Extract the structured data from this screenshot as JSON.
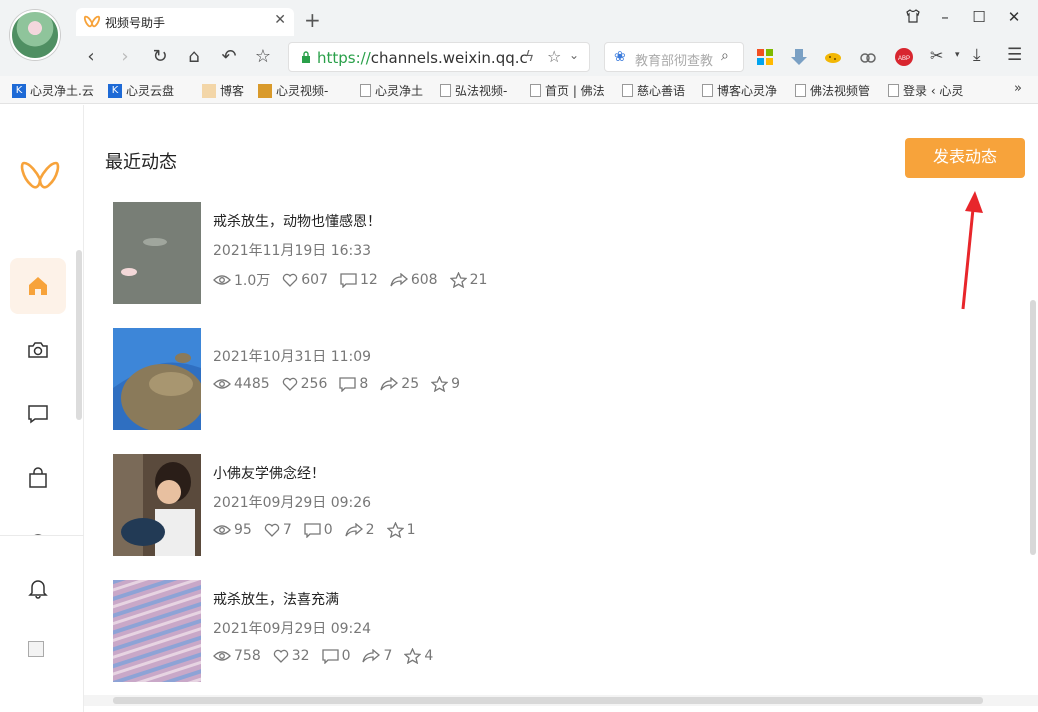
{
  "browser": {
    "tab_title": "视频号助手",
    "url_scheme": "https://",
    "url_host": "channels.weixin.qq.co",
    "search_text": "教育部彻查教",
    "bookmarks": [
      "心灵净土.云",
      "心灵云盘",
      "博客",
      "心灵视频-",
      "心灵净土",
      "弘法视频-",
      "首页 | 佛法",
      "慈心善语",
      "博客心灵净",
      "佛法视频管",
      "登录 ‹ 心灵"
    ],
    "bookmarks_more": "»"
  },
  "page": {
    "section_title": "最近动态",
    "publish_button": "发表动态",
    "accent_color": "#f7a33b"
  },
  "sidebar": {
    "items": [
      {
        "name": "home",
        "icon": "home-icon",
        "active": true
      },
      {
        "name": "camera",
        "icon": "camera-icon"
      },
      {
        "name": "comments",
        "icon": "comment-icon"
      },
      {
        "name": "shop",
        "icon": "shopping-bag-icon"
      },
      {
        "name": "notifications",
        "icon": "bell-icon"
      }
    ]
  },
  "posts": [
    {
      "title": "戒杀放生，动物也懂感恩！",
      "date": "2021年11月19日 16:33",
      "views": "1.0万",
      "likes": "607",
      "comments": "12",
      "shares": "608",
      "favorites": "21"
    },
    {
      "title": "",
      "date": "2021年10月31日 11:09",
      "views": "4485",
      "likes": "256",
      "comments": "8",
      "shares": "25",
      "favorites": "9"
    },
    {
      "title": "小佛友学佛念经！",
      "date": "2021年09月29日 09:26",
      "views": "95",
      "likes": "7",
      "comments": "0",
      "shares": "2",
      "favorites": "1"
    },
    {
      "title": "戒杀放生，法喜充满",
      "date": "2021年09月29日 09:24",
      "views": "758",
      "likes": "32",
      "comments": "0",
      "shares": "7",
      "favorites": "4"
    }
  ]
}
